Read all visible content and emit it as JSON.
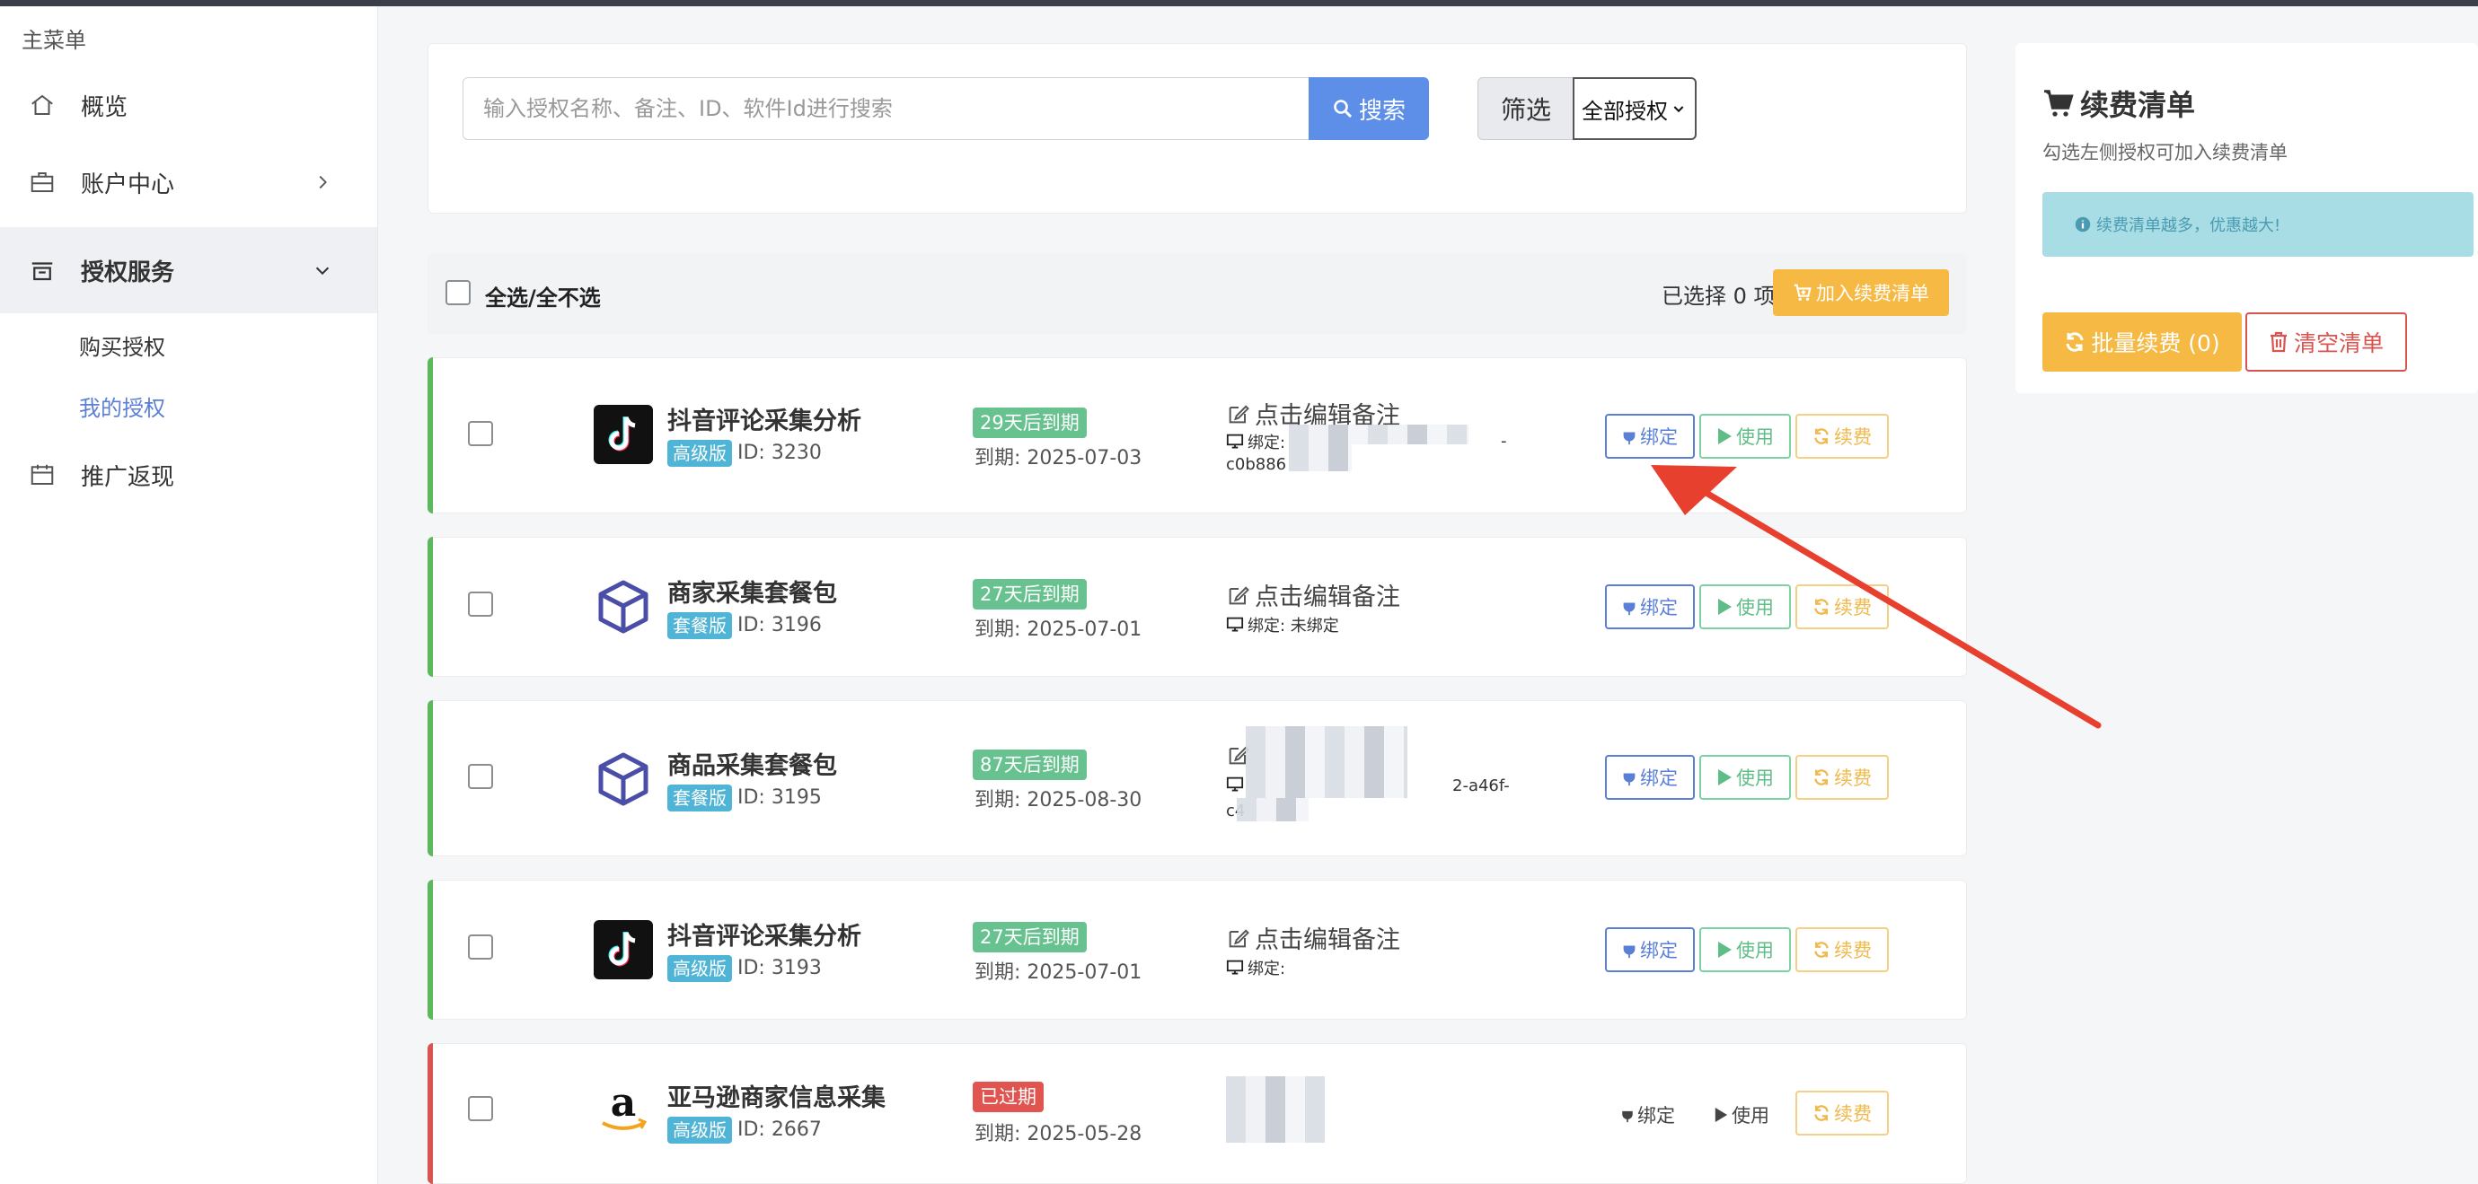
{
  "sidebar": {
    "menu_title": "主菜单",
    "items": [
      {
        "label": "概览",
        "icon": "home-icon"
      },
      {
        "label": "账户中心",
        "icon": "briefcase-icon"
      },
      {
        "label": "授权服务",
        "icon": "stack-icon"
      },
      {
        "label": "推广返现",
        "icon": "calendar-icon"
      }
    ],
    "sub_items": [
      {
        "label": "购买授权"
      },
      {
        "label": "我的授权"
      }
    ]
  },
  "search": {
    "placeholder": "输入授权名称、备注、ID、软件Id进行搜索",
    "button_label": "搜索",
    "filter_label": "筛选",
    "filter_selected": "全部授权"
  },
  "select_bar": {
    "select_all_label": "全选/全不选",
    "selected_text": "已选择 0 项",
    "add_button_label": "加入续费清单"
  },
  "actions": {
    "bind": "绑定",
    "use": "使用",
    "renew": "续费"
  },
  "licenses": [
    {
      "name": "抖音评论采集分析",
      "icon": "tiktok-icon",
      "tier": "高级版",
      "id_text": "ID: 3230",
      "days_badge": "29天后到期",
      "expire": "到期: 2025-07-03",
      "note": "点击编辑备注",
      "bind_label": "绑定:",
      "bind_tail": "-",
      "bind_line2": "c0b886"
    },
    {
      "name": "商家采集套餐包",
      "icon": "cube-icon",
      "tier": "套餐版",
      "id_text": "ID: 3196",
      "days_badge": "27天后到期",
      "expire": "到期: 2025-07-01",
      "note": "点击编辑备注",
      "bind_label": "绑定: 未绑定"
    },
    {
      "name": "商品采集套餐包",
      "icon": "cube-icon",
      "tier": "套餐版",
      "id_text": "ID: 3195",
      "days_badge": "87天后到期",
      "expire": "到期: 2025-08-30",
      "bind_tail": "2-a46f-",
      "bind_line2": "c4"
    },
    {
      "name": "抖音评论采集分析",
      "icon": "tiktok-icon",
      "tier": "高级版",
      "id_text": "ID: 3193",
      "days_badge": "27天后到期",
      "expire": "到期: 2025-07-01",
      "note": "点击编辑备注",
      "bind_label": "绑定:"
    },
    {
      "name": "亚马逊商家信息采集",
      "icon": "amazon-icon",
      "tier": "高级版",
      "id_text": "ID: 2667",
      "days_badge": "已过期",
      "expire": "到期: 2025-05-28"
    }
  ],
  "cart": {
    "title": "续费清单",
    "subtitle": "勾选左侧授权可加入续费清单",
    "alert": "续费清单越多，优惠越大!",
    "batch_label": "批量续费 (0)",
    "clear_label": "清空清单"
  },
  "colors": {
    "accent": "#5d8ee8",
    "active_stripe": "#5cb85c",
    "expired_stripe": "#d9534f",
    "warning": "#f5b944"
  }
}
